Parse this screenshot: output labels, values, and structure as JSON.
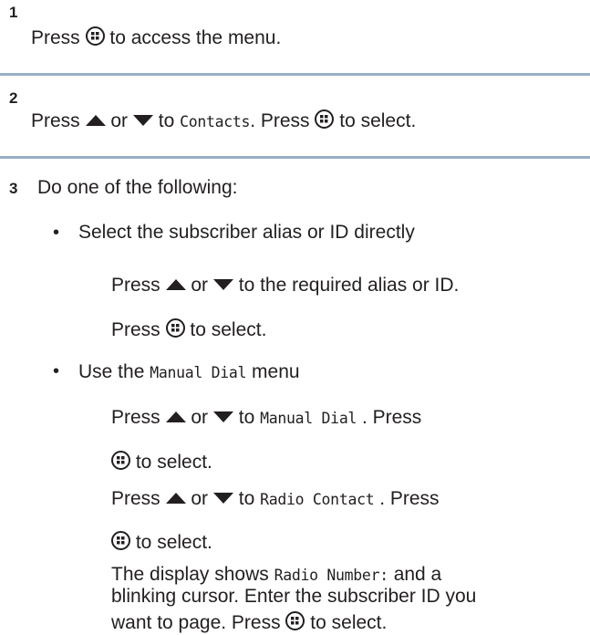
{
  "steps": [
    {
      "number": "1",
      "text_a": "Press",
      "text_b": "to access the menu."
    },
    {
      "number": "2",
      "text_a": "Press",
      "or": "or",
      "to": "to",
      "menu": "Contacts",
      "press": ". Press",
      "select": "to select."
    },
    {
      "number": "3",
      "intro": "Do one of the following:"
    }
  ],
  "option_direct": {
    "bullet": "•",
    "title": "Select the subscriber alias or ID directly",
    "line1_a": "Press",
    "line1_or": "or",
    "line1_b": "to the required alias or ID.",
    "line2_a": "Press",
    "line2_b": "to select."
  },
  "option_manual": {
    "bullet": "•",
    "title_a": "Use the",
    "title_menu": "Manual Dial",
    "title_b": "menu",
    "l1_a": "Press",
    "l1_or": "or",
    "l1_to": "to",
    "l1_menu": "Manual Dial",
    "l1_b": ". Press",
    "l2": "to select.",
    "l3_a": "Press",
    "l3_or": "or",
    "l3_to": "to",
    "l3_menu": "Radio Contact",
    "l3_b": ". Press",
    "l4": "to select.",
    "l5_a": "The display shows",
    "l5_mono": "Radio Number:",
    "l5_b": "and a",
    "l6": "blinking cursor. Enter the subscriber ID you",
    "l7_a": "want to page. Press",
    "l7_b": "to select."
  },
  "icons": [
    "menu-ok-button-icon",
    "up-arrow-icon",
    "down-arrow-icon"
  ],
  "colors": {
    "rule": "#98aec4",
    "text": "#231f20"
  }
}
